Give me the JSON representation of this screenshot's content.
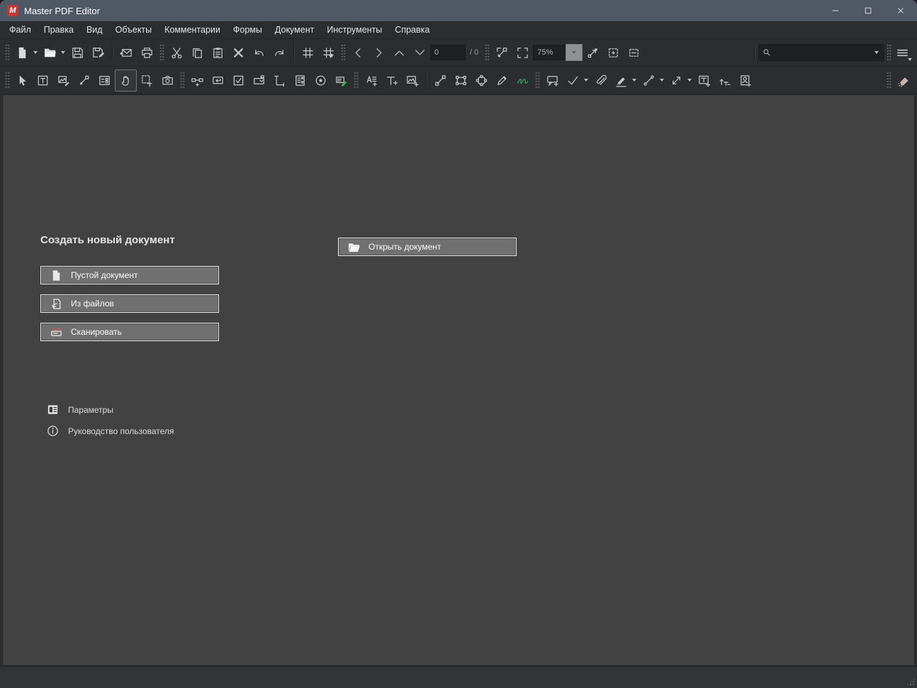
{
  "window": {
    "title": "Master PDF Editor"
  },
  "menu": {
    "items": [
      "Файл",
      "Правка",
      "Вид",
      "Объекты",
      "Комментарии",
      "Формы",
      "Документ",
      "Инструменты",
      "Справка"
    ]
  },
  "toolbar": {
    "page_number": "0",
    "page_total_label": "/ 0",
    "zoom_value": "75%",
    "search_placeholder": ""
  },
  "welcome": {
    "heading": "Создать новый документ",
    "buttons": {
      "blank": "Пустой документ",
      "from_files": "Из файлов",
      "scan": "Сканировать",
      "open": "Открыть документ"
    },
    "links": {
      "settings": "Параметры",
      "guide": "Руководство пользователя"
    }
  },
  "icons": {
    "app-logo": "red rounded square with white M",
    "minimize-icon": "–",
    "maximize-icon": "□",
    "close-icon": "✕",
    "new-document-icon": "blank page",
    "open-icon": "folder",
    "save-icon": "floppy",
    "save-as-icon": "floppy+pencil",
    "email-icon": "envelope",
    "print-icon": "printer",
    "cut-icon": "scissors",
    "copy-icon": "two pages",
    "paste-icon": "clipboard",
    "delete-icon": "✕",
    "undo-icon": "↶",
    "redo-icon": "↷",
    "grid-icon": "#",
    "snap-grid-icon": "# with dot",
    "prev-page-icon": "‹",
    "next-page-icon": "›",
    "page-up-icon": "∧",
    "page-down-icon": "∨",
    "zoom-selection-icon": "frame with arrow",
    "frame-icon": "corner brackets",
    "zoom-fit-icon": "diagonal arrow",
    "fit-page-icon": "dashed frame",
    "fit-width-icon": "dashed frame",
    "search-icon": "magnifier",
    "main-menu-icon": "≡",
    "select-tool-icon": "cursor arrow",
    "edit-text-icon": "[T]",
    "edit-image-icon": "picture+pencil",
    "edit-forms-icon": "node arrow",
    "form-list-icon": "form list",
    "hand-tool-icon": "hand (selected)",
    "select-area-icon": "dashed box T",
    "snapshot-icon": "camera",
    "link-tool-icon": "link+",
    "button-field-icon": "↵",
    "checkbox-field-icon": "☑",
    "combobox-field-icon": "combo box",
    "listbox-field-icon": "L ruler",
    "list-field-icon": "list doc",
    "radio-field-icon": "⊙",
    "signature-field-icon": "field with green pen",
    "edit-add-text-icon": "A lines +",
    "add-text-icon": "T+",
    "add-image-icon": "picture+",
    "line-tool-icon": "line with nodes",
    "rect-tool-icon": "rect with nodes",
    "ellipse-tool-icon": "circle with nodes",
    "pencil-tool-icon": "pencil",
    "freehand-signature-icon": "green squiggle",
    "note-annotation-icon": "speech bubble+",
    "check-stamp-icon": "✓",
    "attachment-icon": "paperclip",
    "highlighter-icon": "marker",
    "line-annotation-icon": "line dots",
    "arrow-annotation-icon": "double arrow",
    "textbox-annotation-icon": "[T]+",
    "callout-annotation-icon": "corner arrow T+",
    "person-stamp-icon": "person card+",
    "eraser-icon": "pink eraser",
    "blank-document-icon": "white page",
    "from-files-icon": "page with arrow",
    "scan-icon": "scanner",
    "open-document-icon": "open folder",
    "settings-icon": "form panel",
    "info-icon": "ⓘ",
    "resize-grip-icon": "dot triangle"
  },
  "colors": {
    "titlebar": "#4f5864",
    "toolbar": "#2b2d2f",
    "canvas": "#424242",
    "accent_red": "#c23a38",
    "button_bg": "#707070",
    "button_border": "#e9e9e9",
    "icon_gray": "#c6c7c8",
    "green_accent": "#3aa657",
    "eraser_pink": "#c8b2b2"
  }
}
